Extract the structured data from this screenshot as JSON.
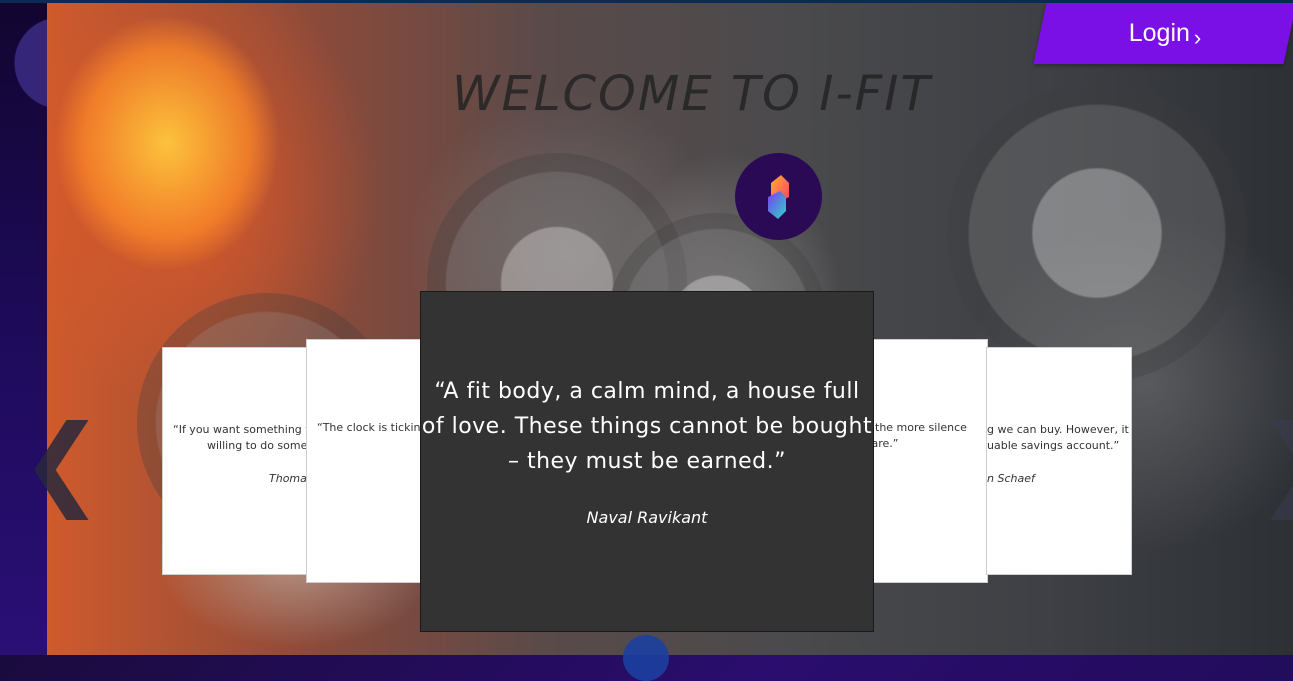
{
  "header": {
    "login_label": "Login",
    "login_chevron": "›",
    "welcome_title": "WELCOME TO I-FIT"
  },
  "logo": {
    "icon": "app-logo-icon",
    "colors": [
      "#ff3d6e",
      "#ffb02e",
      "#2fd5c8",
      "#7a3cf0"
    ]
  },
  "carousel": {
    "prev_arrow": "❮",
    "next_arrow": "❯",
    "cards": [
      {
        "quote_lines": [
          "“If you want something yo",
          "willing to do someth"
        ],
        "author": "Thomas"
      },
      {
        "quote_lines": [
          "“The clock is tickin"
        ],
        "author": ""
      },
      {
        "quote_lines": [
          "“A fit body, a calm mind, a house full",
          "of love. These things cannot be bought",
          "– they must be earned.”"
        ],
        "author": "Naval Ravikant"
      },
      {
        "quote_lines": [
          "the more silence",
          "u are.”"
        ],
        "author": ""
      },
      {
        "quote_lines": [
          "g we can buy. However, it",
          "uable savings account.”"
        ],
        "author": "n Schaef"
      }
    ]
  },
  "colors": {
    "accent": "#7a10e6",
    "card_dark": "#333333"
  }
}
